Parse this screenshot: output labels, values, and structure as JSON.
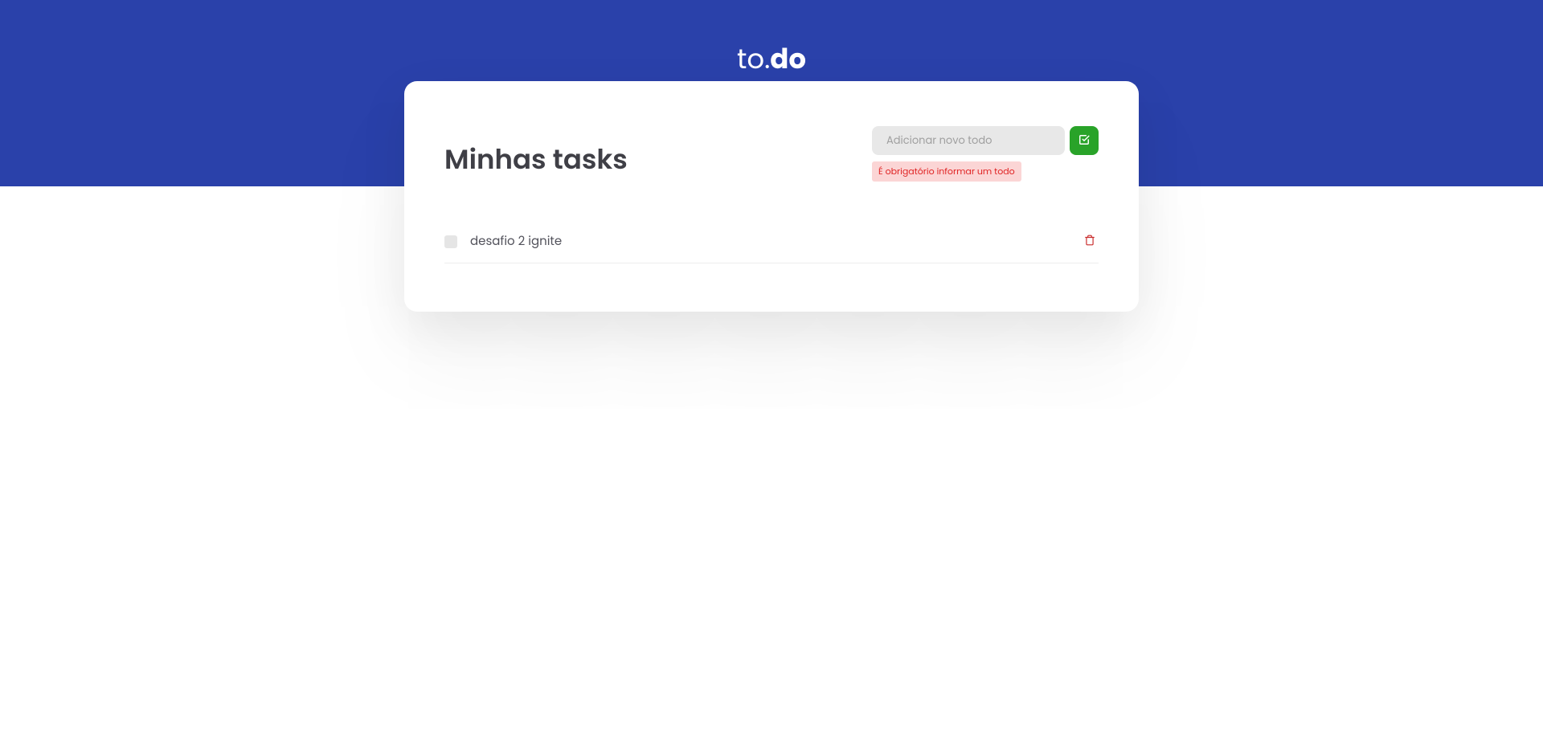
{
  "header": {
    "logo_part1": "to.",
    "logo_part2": "do"
  },
  "card": {
    "title": "Minhas tasks",
    "input": {
      "placeholder": "Adicionar novo todo",
      "value": "",
      "error": "É obrigatório informar um todo"
    }
  },
  "tasks": [
    {
      "label": "desafio 2 ignite",
      "checked": false
    }
  ]
}
